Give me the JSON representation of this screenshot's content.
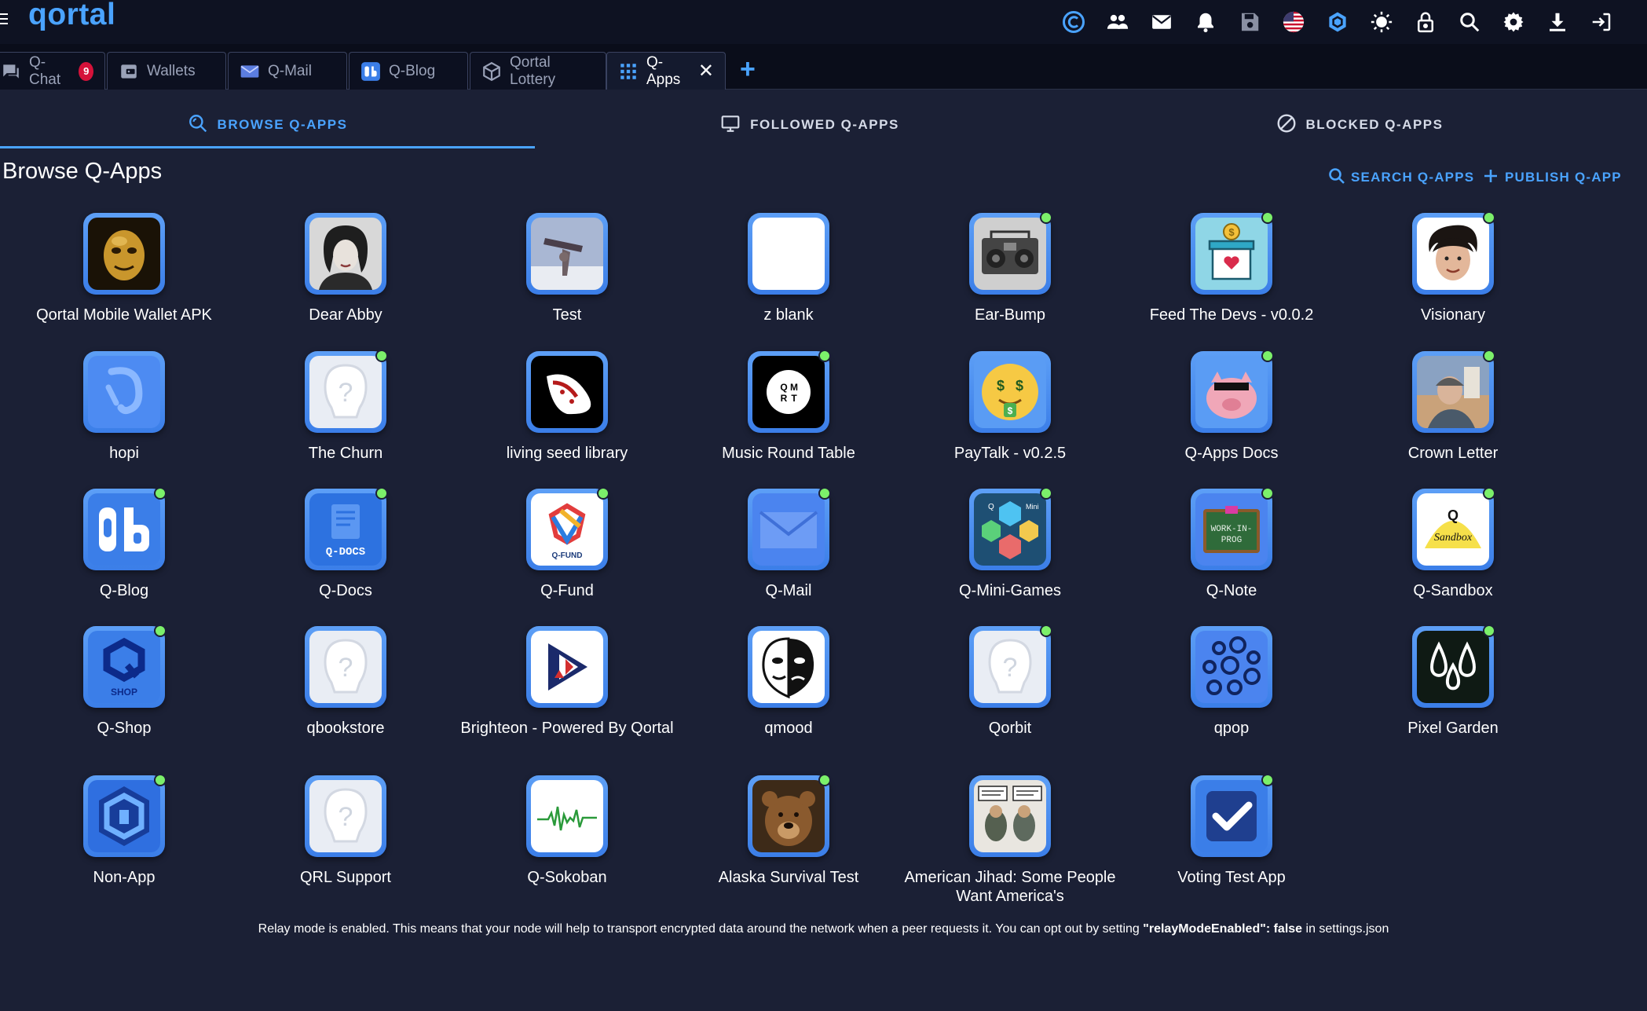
{
  "app": {
    "brand": "qortal"
  },
  "topbar": {
    "icons": [
      "qort-coin-icon",
      "users-icon",
      "mail-icon",
      "bell-icon",
      "save-icon",
      "us-flag-icon",
      "hexagon-icon",
      "sun-icon",
      "lock-icon",
      "search-icon",
      "gear-icon",
      "download-icon",
      "logout-icon"
    ]
  },
  "tabs": [
    {
      "label": "Q-Chat",
      "icon": "chat-icon",
      "badge": "9"
    },
    {
      "label": "Wallets",
      "icon": "wallet-icon"
    },
    {
      "label": "Q-Mail",
      "icon": "mail-icon"
    },
    {
      "label": "Q-Blog",
      "icon": "qblog-icon"
    },
    {
      "label": "Qortal Lottery",
      "icon": "cube-icon"
    },
    {
      "label": "Q-Apps",
      "icon": "grid-icon",
      "active": true
    }
  ],
  "section_tabs": [
    {
      "label": "BROWSE Q-APPS",
      "icon": "browse-icon",
      "active": true
    },
    {
      "label": "FOLLOWED Q-APPS",
      "icon": "monitor-icon"
    },
    {
      "label": "BLOCKED Q-APPS",
      "icon": "block-icon"
    }
  ],
  "page": {
    "title": "Browse Q-Apps",
    "search_label": "SEARCH Q-APPS",
    "publish_label": "PUBLISH Q-APP"
  },
  "apps": [
    {
      "name": "Qortal Mobile Wallet APK",
      "icon": "gold-mask-icon",
      "online": false
    },
    {
      "name": "Dear Abby",
      "icon": "portrait-icon",
      "online": false
    },
    {
      "name": "Test",
      "icon": "test-image-icon",
      "online": false
    },
    {
      "name": "z blank",
      "icon": "blank-icon",
      "online": false
    },
    {
      "name": "Ear-Bump",
      "icon": "boombox-icon",
      "online": true
    },
    {
      "name": "Feed The Devs - v0.0.2",
      "icon": "donation-box-icon",
      "online": true
    },
    {
      "name": "Visionary",
      "icon": "face-icon",
      "online": true
    },
    {
      "name": "hopi",
      "icon": "hopi-symbol-icon",
      "online": false
    },
    {
      "name": "The Churn",
      "icon": "default-avatar-icon",
      "online": true
    },
    {
      "name": "living seed library",
      "icon": "seed-icon",
      "online": false
    },
    {
      "name": "Music Round Table",
      "icon": "round-table-icon",
      "online": true
    },
    {
      "name": "PayTalk - v0.2.5",
      "icon": "money-face-icon",
      "online": false
    },
    {
      "name": "Q-Apps Docs",
      "icon": "pig-icon",
      "online": true
    },
    {
      "name": "Crown Letter",
      "icon": "photo-person-icon",
      "online": true
    },
    {
      "name": "Q-Blog",
      "icon": "qblog-logo-icon",
      "online": true
    },
    {
      "name": "Q-Docs",
      "icon": "qdocs-icon",
      "online": true
    },
    {
      "name": "Q-Fund",
      "icon": "qfund-icon",
      "online": true
    },
    {
      "name": "Q-Mail",
      "icon": "envelope-icon",
      "online": true
    },
    {
      "name": "Q-Mini-Games",
      "icon": "minigames-icon",
      "online": true
    },
    {
      "name": "Q-Note",
      "icon": "chalkboard-icon",
      "online": true
    },
    {
      "name": "Q-Sandbox",
      "icon": "sandbox-icon",
      "online": true
    },
    {
      "name": "Q-Shop",
      "icon": "shop-icon",
      "online": true
    },
    {
      "name": "qbookstore",
      "icon": "default-avatar-icon",
      "online": false
    },
    {
      "name": "Brighteon - Powered By Qortal",
      "icon": "brighteon-icon",
      "online": false
    },
    {
      "name": "qmood",
      "icon": "mask-icon",
      "online": false
    },
    {
      "name": "Qorbit",
      "icon": "default-avatar-icon",
      "online": true
    },
    {
      "name": "qpop",
      "icon": "bubbles-icon",
      "online": false
    },
    {
      "name": "Pixel Garden",
      "icon": "drops-icon",
      "online": true
    },
    {
      "name": "Non-App",
      "icon": "hex-q-icon",
      "online": true
    },
    {
      "name": "QRL Support",
      "icon": "default-avatar-icon",
      "online": false
    },
    {
      "name": "Q-Sokoban",
      "icon": "waveform-icon",
      "online": false
    },
    {
      "name": "Alaska Survival Test",
      "icon": "bear-icon",
      "online": true
    },
    {
      "name": "American Jihad: Some People Want America's",
      "icon": "comic-icon",
      "online": false
    },
    {
      "name": "Voting Test App",
      "icon": "checkmark-icon",
      "online": true
    }
  ],
  "footer": {
    "text_before": "Relay mode is enabled. This means that your node will help to transport encrypted data around the network when a peer requests it. You can opt out by setting ",
    "code": "\"relayModeEnabled\": false",
    "text_after": " in settings.json"
  },
  "colors": {
    "accent": "#4aa3ff",
    "background": "#1b2035",
    "badge": "#d5123a",
    "online": "#7cf06a"
  }
}
